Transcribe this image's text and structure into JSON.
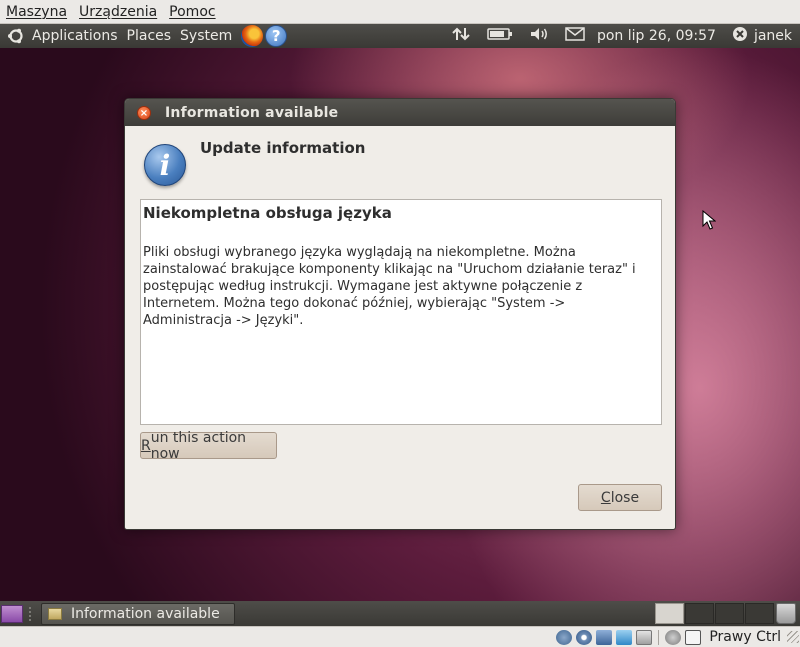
{
  "vbox_menu": {
    "items": [
      "Maszyna",
      "Urządzenia",
      "Pomoc"
    ]
  },
  "top_panel": {
    "menus": [
      "Applications",
      "Places",
      "System"
    ],
    "help_glyph": "?",
    "clock": "pon lip 26, 09:57",
    "user": "janek"
  },
  "dialog": {
    "title": "Information available",
    "close_glyph": "×",
    "info_glyph": "i",
    "header": "Update information",
    "message_heading": "Niekompletna obsługa języka",
    "message_body": "Pliki obsługi wybranego języka wyglądają na niekompletne. Można zainstalować brakujące komponenty klikając na \"Uruchom działanie teraz\" i postępując według instrukcji. Wymagane jest aktywne połączenie z Internetem. Można tego dokonać później, wybierając \"System -> Administracja -> Języki\".",
    "run_button": {
      "underlined": "R",
      "rest": "un this action now"
    },
    "close_button": {
      "underlined": "C",
      "rest": "lose"
    }
  },
  "bottom_panel": {
    "task_label": "Information available",
    "workspace_count": 4,
    "active_workspace": 1
  },
  "vbox_status": {
    "host_key_label": "Prawy Ctrl"
  },
  "icons": {
    "top_panel_tray": [
      "network-updown-icon",
      "battery-icon",
      "volume-icon",
      "mail-icon",
      "session-icon"
    ],
    "status_bar": [
      "hdd-icon",
      "cd-icon",
      "network-icon",
      "shared-folder-icon",
      "usb-icon",
      "mouse-integration-icon",
      "keyboard-capture-icon"
    ]
  }
}
